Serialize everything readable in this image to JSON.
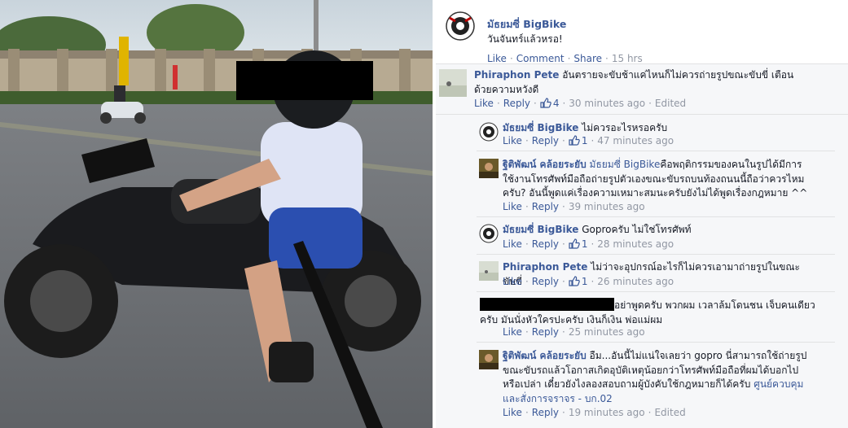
{
  "post": {
    "author": "มัธยมซี่ BigBike",
    "text": "วันจันทร์แล้วหรอ!",
    "actions": {
      "like": "Like",
      "comment": "Comment",
      "share": "Share",
      "time": "15 hrs"
    }
  },
  "comments": [
    {
      "author": "Phiraphon Pete",
      "text": "อันตรายจะขับช้าแค่ไหนก็ไม่ควรถ่ายรูปขณะขับขี่ เตือนด้วยความหวังดี",
      "like": "Like",
      "reply": "Reply",
      "likes": "4",
      "time": "30 minutes ago",
      "edited": "Edited"
    },
    {
      "author": "มัธยมซี่ BigBike",
      "text": "ไม่ควรอะไรหรอครับ",
      "like": "Like",
      "reply": "Reply",
      "likes": "1",
      "time": "47 minutes ago"
    },
    {
      "author": "ฐิติพัฒน์ คล้อยระยับ",
      "tag": "มัธยมซี่ BigBike",
      "text": "คือพฤติกรรมของคนในรูปได้มีการใช้งานโทรศัพท์มือถือถ่ายรูปตัวเองขณะขับรถบนท้องถนนนี้ถือว่าควรไหมครับ? อันนี้พูดแค่เรื่องความเหมาะสมนะครับยังไม่ได้พูดเรื่องกฎหมาย ^^",
      "like": "Like",
      "reply": "Reply",
      "time": "39 minutes ago"
    },
    {
      "author": "มัธยมซี่ BigBike",
      "text": "Goproครับ ไม่ใช่โทรศัพท์",
      "like": "Like",
      "reply": "Reply",
      "likes": "1",
      "time": "28 minutes ago"
    },
    {
      "author": "Phiraphon Pete",
      "text": "ไม่ว่าจะอุปกรณ์อะไรก็ไม่ควรเอามาถ่ายรูปในขณะขับขี่",
      "like": "Like",
      "reply": "Reply",
      "likes": "1",
      "time": "26 minutes ago"
    },
    {
      "text": "อย่าพูดครับ พวกผม เวลาล้มโดนชน เจ็บคนเดียวครับ มันนั่งหัวใครปะครับ เงินก็เงิน พ่อแม่ผม",
      "like": "Like",
      "reply": "Reply",
      "time": "25 minutes ago"
    },
    {
      "author": "ฐิติพัฒน์ คล้อยระยับ",
      "text": "อืม...อันนี้ไม่แน่ใจเลยว่า gopro นี่สามารถใช้ถ่ายรูปขณะขับรถแล้วโอกาสเกิดอุบัติเหตุน้อยกว่าโทรศัพท์มือถือที่ผมได้บอกไปหรือเปล่า เดี๋ยวยังไงลองสอบถามผู้บังคับใช้กฎหมายก็ได้ครับ",
      "tag": "ศูนย์ควบคุมและสั่งการจราจร - บก.02",
      "like": "Like",
      "reply": "Reply",
      "time": "19 minutes ago",
      "edited": "Edited"
    }
  ],
  "colors": {
    "link": "#3b5998",
    "meta": "#9197a3",
    "comments_bg": "#f6f7f9"
  },
  "icons": [
    "thumbs-up-icon",
    "page-logo-icon"
  ]
}
